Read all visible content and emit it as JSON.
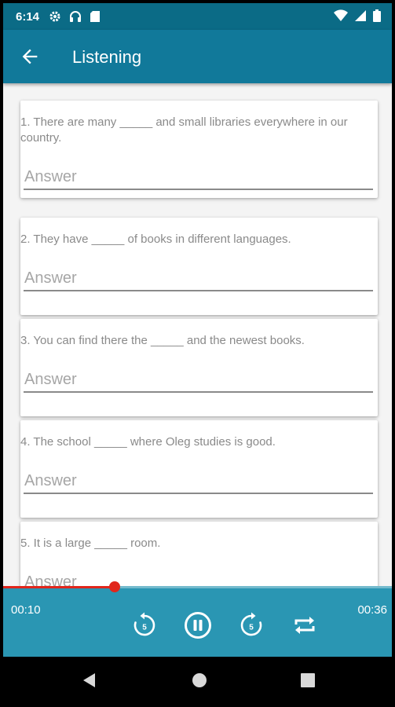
{
  "status_bar": {
    "time": "6:14"
  },
  "app_bar": {
    "title": "Listening"
  },
  "questions": [
    {
      "text": "1. There are many _____ and small libraries everywhere in our country.",
      "placeholder": "Answer"
    },
    {
      "text": "2. They have _____ of books in different languages.",
      "placeholder": "Answer"
    },
    {
      "text": "3. You can find there the _____ and the newest books.",
      "placeholder": "Answer"
    },
    {
      "text": "4. The school _____ where Oleg studies is good.",
      "placeholder": "Answer"
    },
    {
      "text": "5. It is a large _____ room.",
      "placeholder": "Answer"
    }
  ],
  "player": {
    "elapsed": "00:10",
    "duration": "00:36",
    "progress_percent": 28.7,
    "rewind_seconds": "5",
    "forward_seconds": "5"
  },
  "colors": {
    "status_bar": "#0b6b86",
    "app_bar": "#11799a",
    "player": "#2a96b3",
    "progress": "#e1261c"
  },
  "icons": {
    "back": "arrow-left-icon",
    "rewind": "replay-5-icon",
    "pause": "pause-circle-icon",
    "forward": "forward-5-icon",
    "repeat": "repeat-icon"
  }
}
